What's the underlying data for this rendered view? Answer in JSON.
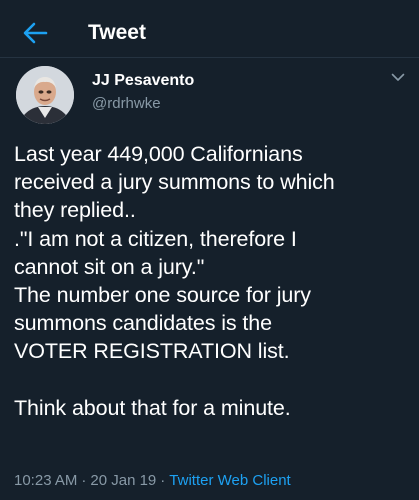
{
  "header": {
    "back_icon": "arrow-left-icon",
    "title": "Tweet",
    "accent_color": "#1da1f2"
  },
  "author": {
    "avatar_icon": "user-avatar",
    "name": "JJ Pesavento",
    "handle": "@rdrhwke",
    "menu_icon": "chevron-down-icon"
  },
  "tweet": {
    "lines": [
      "Last year 449,000 Californians",
      "received a jury summons to which",
      "they replied..",
      ".\"I am not a citizen, therefore I",
      "cannot sit on a jury.\"",
      "The number one source for jury",
      "summons candidates is the",
      "VOTER REGISTRATION list.",
      "",
      "Think about that for a minute."
    ]
  },
  "meta": {
    "time": "10:23 AM",
    "separator": "·",
    "date": "20 Jan 19",
    "client": "Twitter Web Client"
  },
  "colors": {
    "background": "#15202b",
    "text": "#ffffff",
    "secondary_text": "#8899a6",
    "link": "#1da1f2"
  }
}
